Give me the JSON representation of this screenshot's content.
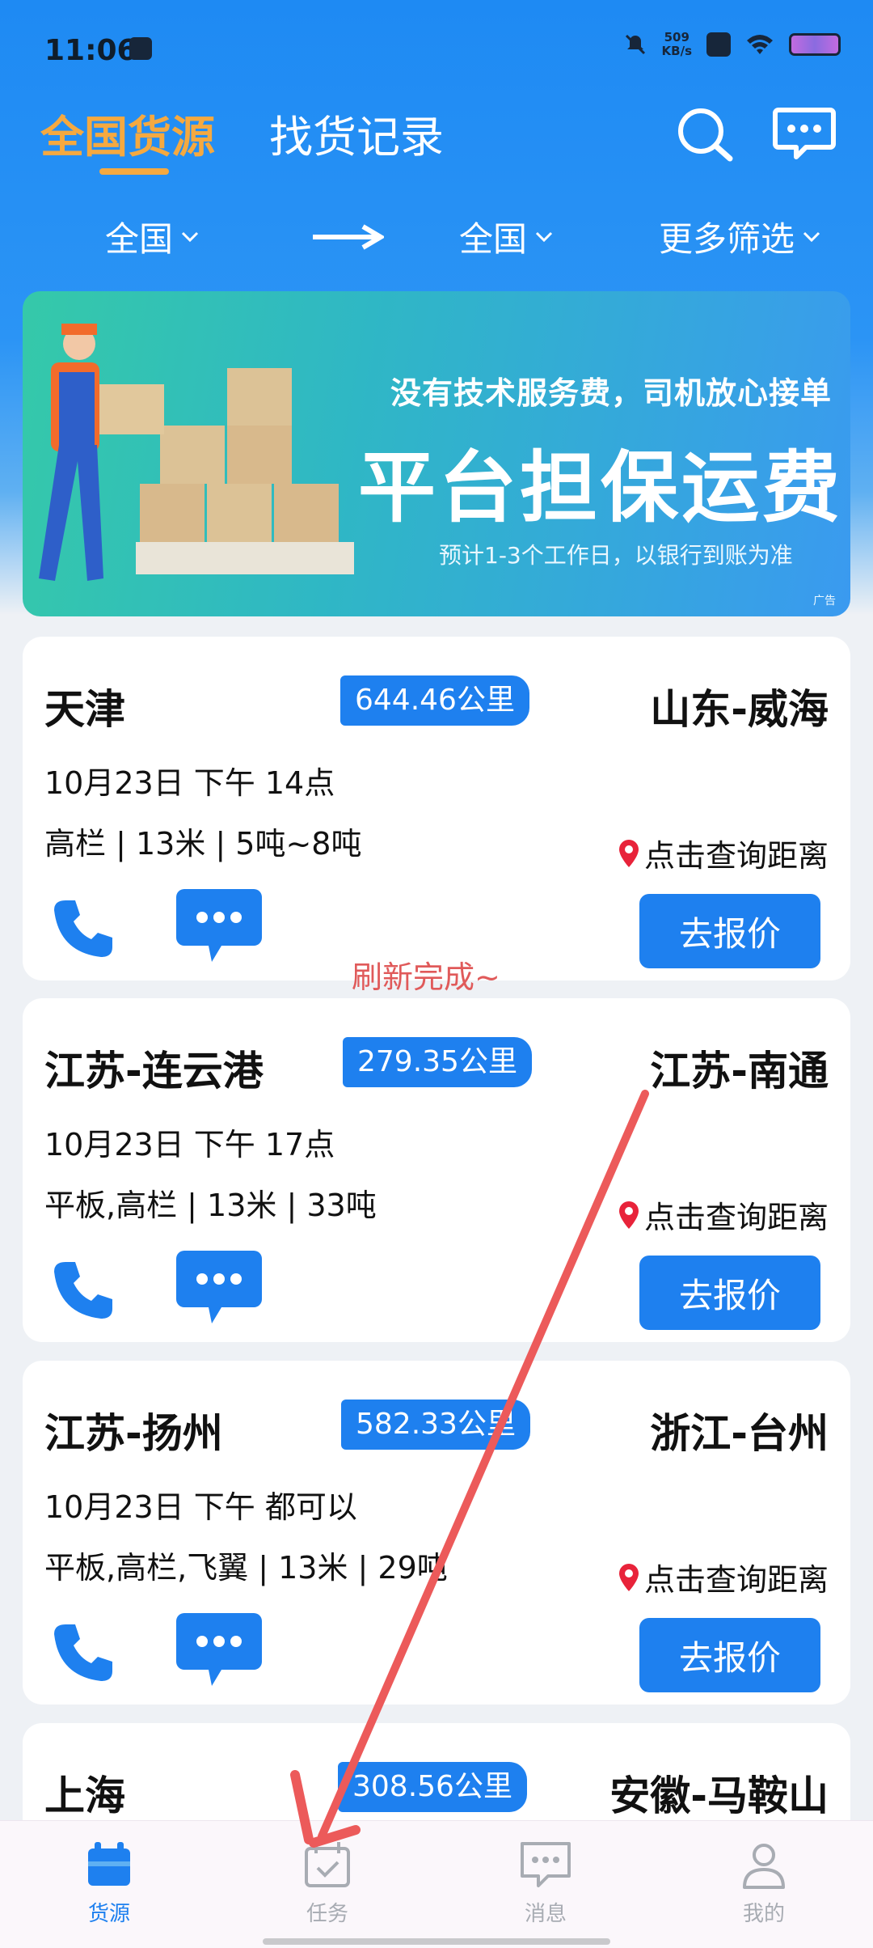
{
  "status_bar": {
    "time": "11:06",
    "speed_value": "509",
    "speed_unit": "KB/s"
  },
  "header": {
    "tabs": [
      {
        "label": "全国货源",
        "active": true
      },
      {
        "label": "找货记录",
        "active": false
      }
    ],
    "icons": [
      "search-icon",
      "chat-icon"
    ]
  },
  "filters": {
    "origin": "全国",
    "destination": "全国",
    "more": "更多筛选"
  },
  "banner": {
    "line1": "没有技术服务费，司机放心接单",
    "line2": "平台担保运费",
    "line3": "预计1-3个工作日，以银行到账为准",
    "ad_label": "广告"
  },
  "cargo_list": [
    {
      "from": "天津",
      "distance": "644.46公里",
      "to": "山东-威海",
      "time": "10月23日 下午 14点",
      "spec": "高栏 | 13米 | 5吨~8吨",
      "query": "点击查询距离",
      "quote_label": "去报价"
    },
    {
      "from": "江苏-连云港",
      "distance": "279.35公里",
      "to": "江苏-南通",
      "time": "10月23日 下午 17点",
      "spec": "平板,高栏 | 13米 | 33吨",
      "query": "点击查询距离",
      "quote_label": "去报价"
    },
    {
      "from": "江苏-扬州",
      "distance": "582.33公里",
      "to": "浙江-台州",
      "time": "10月23日 下午 都可以",
      "spec": "平板,高栏,飞翼 | 13米 | 29吨",
      "query": "点击查询距离",
      "quote_label": "去报价"
    },
    {
      "from": "上海",
      "distance": "308.56公里",
      "to": "安徽-马鞍山"
    }
  ],
  "toast": "刷新完成~",
  "bottom_nav": [
    {
      "label": "货源",
      "icon": "cargo-icon",
      "active": true
    },
    {
      "label": "任务",
      "icon": "task-icon",
      "active": false
    },
    {
      "label": "消息",
      "icon": "message-icon",
      "active": false
    },
    {
      "label": "我的",
      "icon": "profile-icon",
      "active": false
    }
  ],
  "colors": {
    "primary": "#1e80ef",
    "accent": "#f5a940",
    "toast": "#e05a5a",
    "annotation_arrow": "#ec5a5a"
  }
}
